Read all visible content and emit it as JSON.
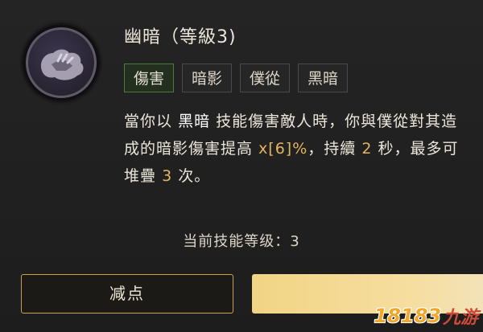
{
  "skill": {
    "icon": "dark-hand-icon",
    "title": "幽暗（等級3)",
    "tags": [
      {
        "label": "傷害",
        "active": true
      },
      {
        "label": "暗影",
        "active": false
      },
      {
        "label": "僕從",
        "active": false
      },
      {
        "label": "黑暗",
        "active": false
      }
    ],
    "description": {
      "p1": "當你以",
      "p2": "黑暗",
      "p3": "技能傷害敵人時，你與僕從對其造成的暗影傷害提高",
      "p4": "x[6]%",
      "p5": "，持續",
      "p6": "2",
      "p7": "秒，最多可堆疊",
      "p8": "3",
      "p9": "次。"
    },
    "current_level_text": "当前技能等级：3"
  },
  "buttons": {
    "decrease": "减点"
  },
  "watermark": {
    "number": "18183",
    "text": "九游"
  },
  "colors": {
    "highlight_number": "#e4b560",
    "active_tag_border": "#4f7a3f",
    "button_gold": "#f1d484"
  }
}
